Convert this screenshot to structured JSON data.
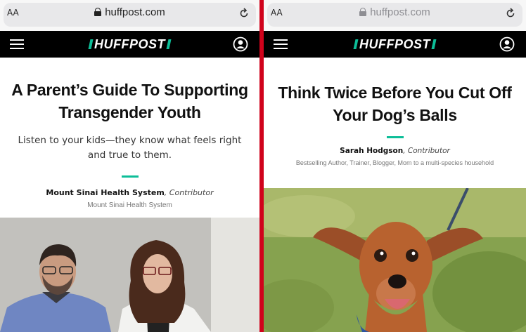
{
  "left": {
    "url_bar": {
      "aa": "AA",
      "url": "huffpost.com"
    },
    "logo": "HUFFPOST",
    "article": {
      "title_line1": "A Parent’s Guide To Supporting",
      "title_line2": "Transgender Youth",
      "dek_line1": "Listen to your kids—they know what feels right",
      "dek_line2": "and true to them.",
      "author": "Mount Sinai Health System",
      "role": "Contributor",
      "author_bio": "Mount Sinai Health System"
    }
  },
  "right": {
    "url_bar": {
      "aa": "AA",
      "url": "huffpost.com"
    },
    "logo": "HUFFPOST",
    "article": {
      "title_line1": "Think Twice Before You Cut Off",
      "title_line2": "Your Dog’s Balls",
      "author": "Sarah Hodgson",
      "role": "Contributor",
      "author_bio": "Bestselling Author, Trainer, Blogger, Mom to a multi-species household"
    }
  },
  "colors": {
    "divider_red": "#d0021b",
    "accent_green": "#0dbe98",
    "nav_black": "#000000"
  },
  "icons": [
    "lock-icon",
    "reload-icon",
    "hamburger-menu-icon",
    "user-account-icon"
  ]
}
